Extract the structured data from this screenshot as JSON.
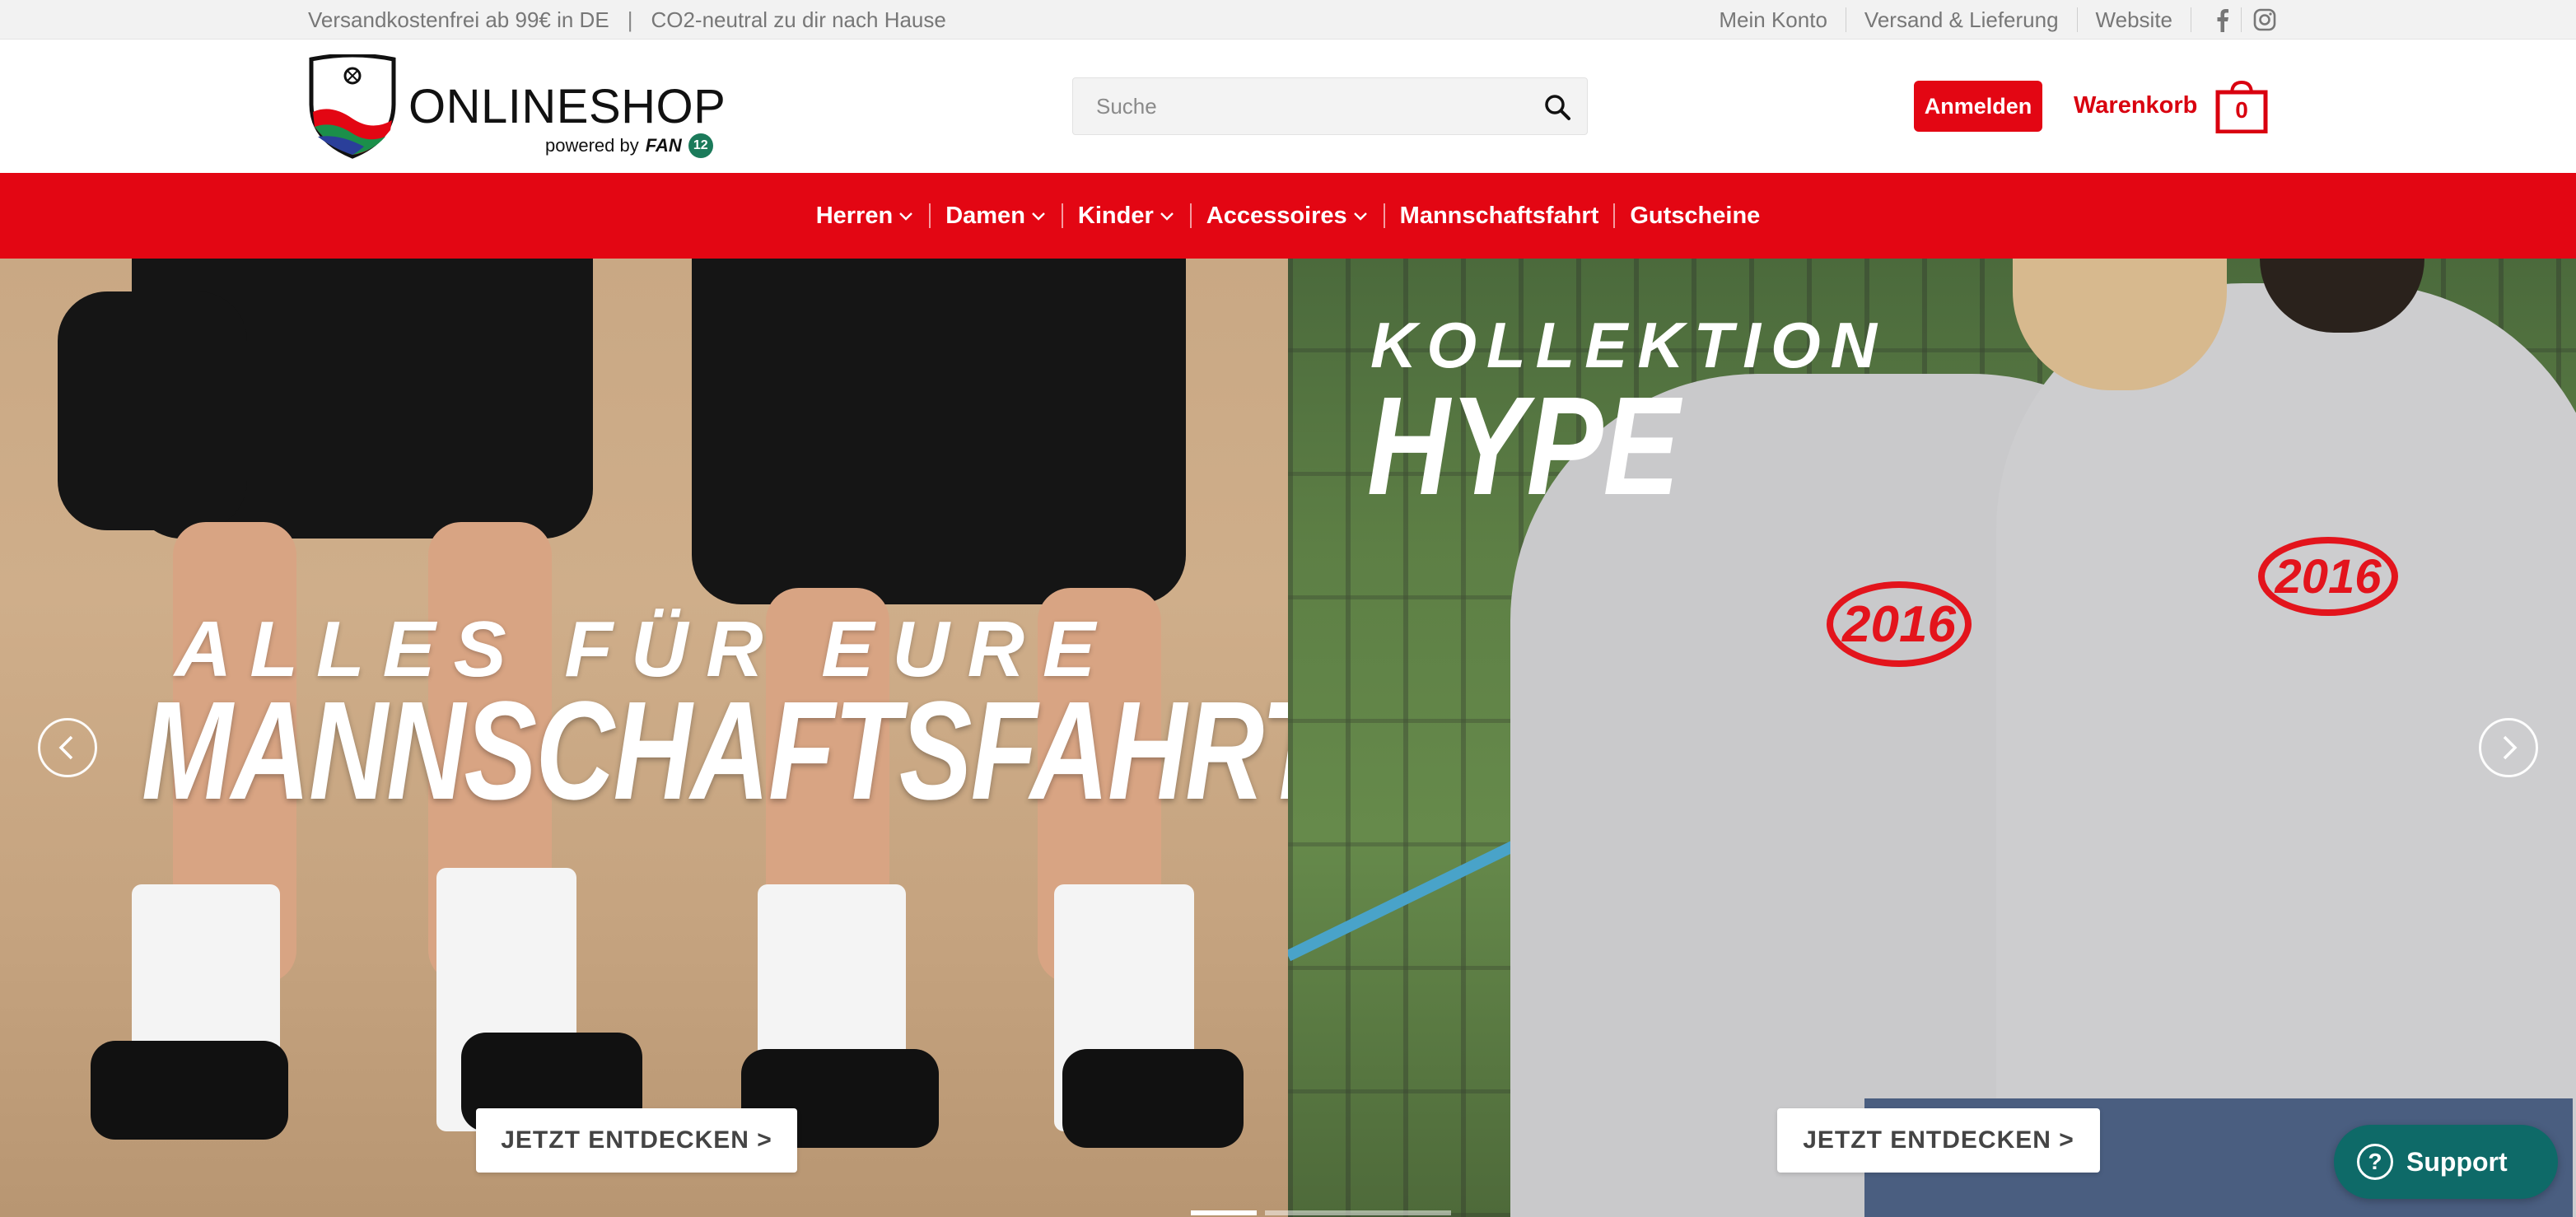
{
  "topbar": {
    "shipping_text": "Versandkostenfrei ab 99€ in DE",
    "separator": "|",
    "co2_text": "CO2-neutral zu dir nach Hause",
    "links": [
      "Mein Konto",
      "Versand & Lieferung",
      "Website"
    ],
    "social_icons": [
      "facebook-icon",
      "instagram-icon"
    ]
  },
  "header": {
    "logo_text": "ONLINESHOP",
    "powered_by": "powered by",
    "powered_brand": "FAN",
    "powered_number": "12",
    "search_placeholder": "Suche",
    "login_label": "Anmelden",
    "cart_label": "Warenkorb",
    "cart_count": "0"
  },
  "nav": {
    "items": [
      {
        "label": "Herren",
        "dropdown": true
      },
      {
        "label": "Damen",
        "dropdown": true
      },
      {
        "label": "Kinder",
        "dropdown": true
      },
      {
        "label": "Accessoires",
        "dropdown": true
      },
      {
        "label": "Mannschaftsfahrt",
        "dropdown": false
      },
      {
        "label": "Gutscheine",
        "dropdown": false
      }
    ]
  },
  "hero": {
    "left": {
      "headline_small": "ALLES FÜR EURE",
      "headline_big": "MANNSCHAFTSFAHRT",
      "cta": "JETZT ENTDECKEN >"
    },
    "right": {
      "headline_small": "KOLLEKTION",
      "headline_big": "HYPE",
      "cta": "JETZT ENTDECKEN >",
      "emblem_text": "2016"
    }
  },
  "support": {
    "label": "Support"
  },
  "colors": {
    "brand_red": "#e30613",
    "support_teal": "#0e6a68"
  }
}
